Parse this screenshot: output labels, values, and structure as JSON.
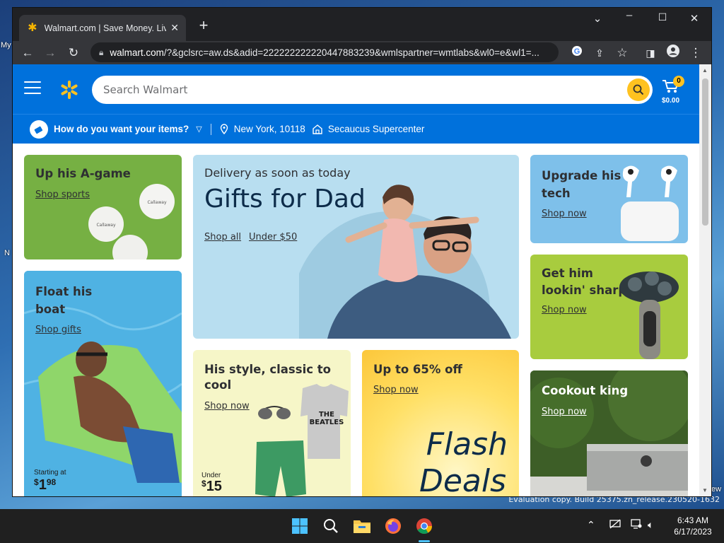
{
  "desktop": {
    "labels": [
      "My",
      "N"
    ],
    "watermark_right": "ew",
    "watermark": "Evaluation copy. Build 25375.zn_release.230520-1632"
  },
  "browser": {
    "tab_title": "Walmart.com | Save Money. Live",
    "url_host": "walmart.com",
    "url_rest": "/?&gclsrc=aw.ds&adid=222222222220447883239&wmlspartner=wmtlabs&wl0=e&wl1=..."
  },
  "walmart": {
    "search_placeholder": "Search Walmart",
    "cart_count": "0",
    "cart_total": "$0.00",
    "delivery_question": "How do you want your items?",
    "location": "New York, 10118",
    "store": "Secaucus Supercenter",
    "brand_color": "#0071dc",
    "accent_color": "#ffc220"
  },
  "cards": {
    "agame": {
      "title": "Up his A-game",
      "link": "Shop sports"
    },
    "hero": {
      "subtitle": "Delivery as soon as today",
      "title": "Gifts for Dad",
      "link1": "Shop all",
      "link2": "Under $50"
    },
    "tech": {
      "title_line1": "Upgrade his",
      "title_line2": "tech",
      "link": "Shop now"
    },
    "boat": {
      "title_line1": "Float his",
      "title_line2": "boat",
      "link": "Shop gifts",
      "price_prefix": "Starting at",
      "price_dollars": "1",
      "price_cents": "98"
    },
    "style": {
      "title_line1": "His style, classic to",
      "title_line2": "cool",
      "link": "Shop now",
      "price_prefix": "Under",
      "price_dollars": "15",
      "shirt_text": "THE BEATLES"
    },
    "flash": {
      "title": "Up to 65% off",
      "link": "Shop now",
      "big1": "Flash",
      "big2": "Deals"
    },
    "sharp": {
      "title_line1": "Get him",
      "title_line2": "lookin' sharp",
      "link": "Shop now"
    },
    "cookout": {
      "title": "Cookout king",
      "link": "Shop now"
    }
  },
  "taskbar": {
    "time": "6:43 AM",
    "date": "6/17/2023",
    "icons": [
      "windows-start",
      "search",
      "file-explorer",
      "firefox",
      "chrome"
    ]
  }
}
